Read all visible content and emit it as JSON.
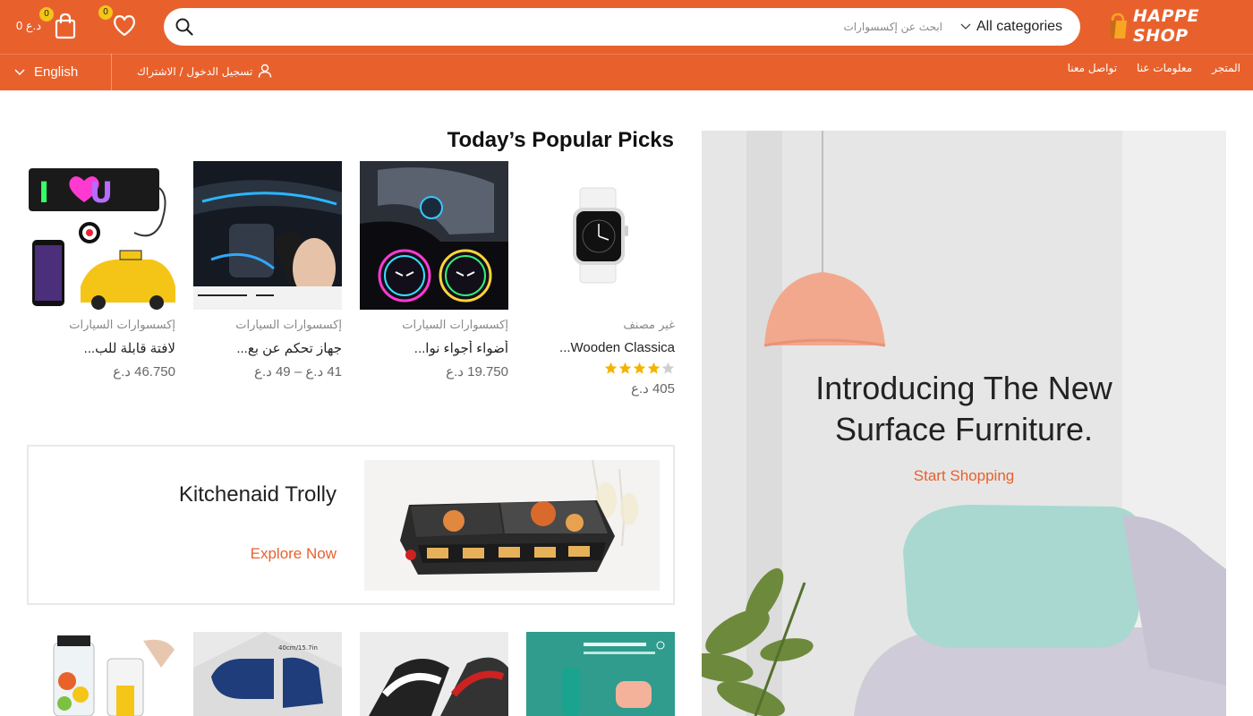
{
  "header": {
    "logo_text": "HAPPE SHOP",
    "search": {
      "placeholder": "ابحث عن إكسسوارات",
      "category": "All categories"
    },
    "wishlist_count": "0",
    "cart_count": "0",
    "cart_total": "0 د.ع"
  },
  "nav": {
    "language": "English",
    "login": "تسجيل الدخول / الاشتراك",
    "menu": [
      "المتجر",
      "معلومات عنا",
      "تواصل معنا"
    ]
  },
  "hero": {
    "title_line1": "Introducing The New",
    "title_line2": "Surface Furniture.",
    "cta": "Start Shopping"
  },
  "popular": {
    "title": "Today’s Popular Picks",
    "products": [
      {
        "category": "غير مصنف",
        "name": "Wooden Classica...",
        "rating": 4,
        "price": "405 د.ع"
      },
      {
        "category": "إكسسوارات السيارات",
        "name": "أضواء أجواء نوا...",
        "price": "19.750 د.ع"
      },
      {
        "category": "إكسسوارات السيارات",
        "name": "جهاز تحكم عن بع...",
        "price": "41 د.ع – 49 د.ع"
      },
      {
        "category": "إكسسوارات السيارات",
        "name": "لافتة قابلة للب...",
        "price": "46.750 د.ع"
      }
    ]
  },
  "promo": {
    "title": "Kitchenaid Trolly",
    "cta": "Explore Now"
  },
  "colors": {
    "brand": "#e8612d",
    "badge": "#f5c518",
    "star": "#f5b301"
  }
}
